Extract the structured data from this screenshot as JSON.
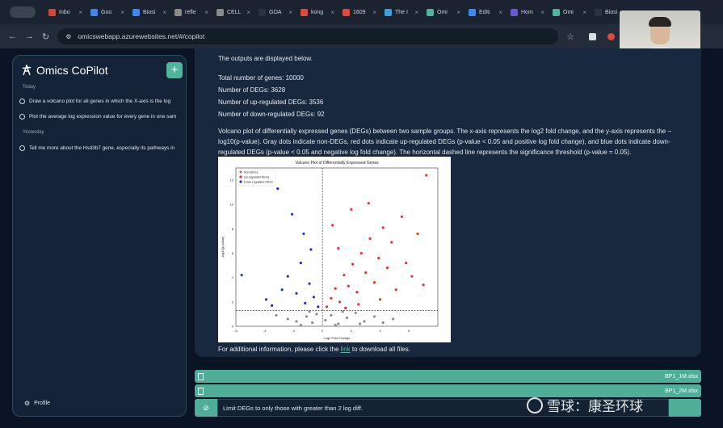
{
  "browser": {
    "tabs": [
      {
        "label": "Inbo",
        "color": "#d44638"
      },
      {
        "label": "Goo",
        "color": "#4285f4"
      },
      {
        "label": "Biosi",
        "color": "#4285f4"
      },
      {
        "label": "refle",
        "color": "#8a8a8a"
      },
      {
        "label": "CELL",
        "color": "#8a8a8a"
      },
      {
        "label": "GOA",
        "color": "#2a3444"
      },
      {
        "label": "kong",
        "color": "#e04a3a"
      },
      {
        "label": "1609",
        "color": "#e04a3a"
      },
      {
        "label": "The I",
        "color": "#3aa0e0"
      },
      {
        "label": "Omi",
        "color": "#4fb59b"
      },
      {
        "label": "Editi",
        "color": "#4285f4"
      },
      {
        "label": "Hom",
        "color": "#6a5acd"
      },
      {
        "label": "Omi",
        "color": "#4fb59b"
      },
      {
        "label": "Biosi",
        "color": "#2a3444"
      }
    ],
    "url": "omicswebapp.azurewebsites.net/#/copilot"
  },
  "sidebar": {
    "brand": "Omics CoPilot",
    "new_chat_label": "+",
    "today_label": "Today",
    "today_items": [
      "Draw a volcano plot for all genes in which the X-axis is the log",
      "Plot the average log expression value for every gene in one sam"
    ],
    "yesterday_label": "Yesterday",
    "yesterday_items": [
      "Tell me more about the Hsd3b7 gene, especially its pathways in"
    ],
    "profile_label": "Profile"
  },
  "chat": {
    "intro": "The outputs are displayed below.",
    "stats": [
      "Total number of genes: 10000",
      "Number of DEGs: 3628",
      "Number of up-regulated DEGs: 3536",
      "Number of down-regulated DEGs: 92"
    ],
    "description_lines": [
      "Volcano plot of differentially expressed genes (DEGs) between two sample groups. The x-axis represents the log2 fold change, and the y-axis represents the −",
      "log10(p-value). Gray dots indicate non-DEGs, red dots indicate up-regulated DEGs (p-value < 0.05 and positive log fold change), and blue dots indicate down-",
      "regulated DEGs (p-value < 0.05 and negative log fold change). The horizontal dashed line represents the significance threshold (p-value = 0.05)."
    ],
    "footer_before": "For additional information, please click the ",
    "footer_link": "link",
    "footer_after": " to download all files."
  },
  "chart_data": {
    "type": "scatter",
    "title": "Volcano Plot of Differentially Expressed Genes",
    "xlabel": "Log2 Fold Change",
    "ylabel": "-log10(p-value)",
    "xlim": [
      -6,
      8
    ],
    "ylim": [
      0,
      13
    ],
    "xticks": [
      -6,
      -4,
      -2,
      0,
      2,
      4,
      6
    ],
    "yticks": [
      0,
      2,
      4,
      6,
      8,
      10,
      12
    ],
    "threshold_y": 1.3,
    "threshold_x": 0,
    "series": [
      {
        "name": "Non-DEGs",
        "color": "#8c8c8c",
        "points": [
          [
            -3.2,
            0.9
          ],
          [
            -2.4,
            0.6
          ],
          [
            -1.8,
            0.4
          ],
          [
            -1.1,
            0.8
          ],
          [
            -0.7,
            0.3
          ],
          [
            -0.4,
            1.0
          ],
          [
            0.2,
            0.5
          ],
          [
            0.6,
            0.9
          ],
          [
            1.1,
            0.2
          ],
          [
            1.7,
            0.7
          ],
          [
            2.3,
            1.1
          ],
          [
            2.9,
            0.4
          ],
          [
            3.6,
            0.8
          ],
          [
            4.2,
            0.3
          ],
          [
            4.9,
            0.6
          ],
          [
            -0.9,
            1.2
          ],
          [
            1.4,
            1.2
          ],
          [
            0.9,
            0.1
          ],
          [
            -1.5,
            0.1
          ],
          [
            2.6,
            0.2
          ]
        ]
      },
      {
        "name": "Up-regulated DEGs",
        "color": "#e8322b",
        "points": [
          [
            0.3,
            1.6
          ],
          [
            0.6,
            2.3
          ],
          [
            0.9,
            3.1
          ],
          [
            1.2,
            2.0
          ],
          [
            1.5,
            4.2
          ],
          [
            1.8,
            3.3
          ],
          [
            2.1,
            5.1
          ],
          [
            2.4,
            2.8
          ],
          [
            2.7,
            6.0
          ],
          [
            3.0,
            4.4
          ],
          [
            3.3,
            7.2
          ],
          [
            3.6,
            3.6
          ],
          [
            3.9,
            5.6
          ],
          [
            4.2,
            8.1
          ],
          [
            4.5,
            4.8
          ],
          [
            4.8,
            6.9
          ],
          [
            5.1,
            3.0
          ],
          [
            5.5,
            9.0
          ],
          [
            5.8,
            5.2
          ],
          [
            6.2,
            4.1
          ],
          [
            6.6,
            7.6
          ],
          [
            7.0,
            3.4
          ],
          [
            7.2,
            12.4
          ],
          [
            2.0,
            9.6
          ],
          [
            3.2,
            10.1
          ],
          [
            1.1,
            6.4
          ],
          [
            0.7,
            8.3
          ],
          [
            4.0,
            2.2
          ],
          [
            2.5,
            1.8
          ],
          [
            1.6,
            1.5
          ]
        ]
      },
      {
        "name": "Down-regulated DEGs",
        "color": "#2233cc",
        "points": [
          [
            -0.3,
            1.6
          ],
          [
            -0.6,
            2.4
          ],
          [
            -0.9,
            3.5
          ],
          [
            -1.2,
            1.9
          ],
          [
            -1.5,
            5.2
          ],
          [
            -1.8,
            2.7
          ],
          [
            -2.1,
            9.2
          ],
          [
            -2.4,
            4.1
          ],
          [
            -2.8,
            3.0
          ],
          [
            -3.1,
            11.3
          ],
          [
            -3.5,
            1.7
          ],
          [
            -3.9,
            2.2
          ],
          [
            -4.3,
            12.4
          ],
          [
            -5.6,
            4.2
          ],
          [
            -0.8,
            6.3
          ],
          [
            -1.3,
            7.6
          ]
        ]
      }
    ]
  },
  "files": [
    {
      "name": "BP1_1M.xlsx"
    },
    {
      "name": "BP1_2M.xlsx"
    }
  ],
  "input": {
    "value": "Limit DEGs to only those with greater than 2 log diff.",
    "attach_label": "⊘"
  },
  "watermark": {
    "text": "雪球：康圣环球"
  }
}
